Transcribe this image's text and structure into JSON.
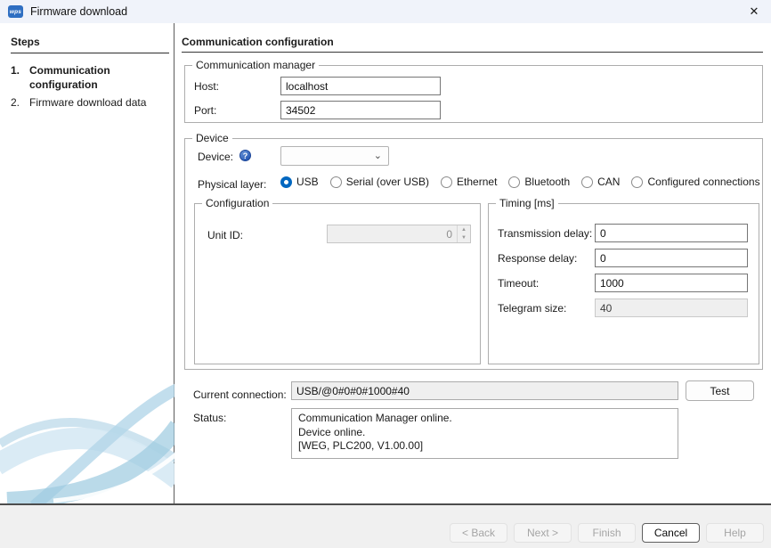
{
  "window": {
    "title": "Firmware download",
    "app_icon_text": "wps"
  },
  "icons": {
    "close": "✕",
    "chevron_down": "⌄",
    "help": "?",
    "spin_up": "▲",
    "spin_down": "▼"
  },
  "sidebar": {
    "heading": "Steps",
    "steps": [
      {
        "number": "1.",
        "label": "Communication configuration"
      },
      {
        "number": "2.",
        "label": "Firmware download data"
      }
    ]
  },
  "main": {
    "header": "Communication configuration",
    "comm_manager": {
      "legend": "Communication manager",
      "host_label": "Host:",
      "host_value": "localhost",
      "port_label": "Port:",
      "port_value": "34502"
    },
    "device": {
      "legend": "Device",
      "device_label": "Device:",
      "device_value": "",
      "physical_layer_label": "Physical layer:",
      "options": [
        {
          "label": "USB",
          "selected": true
        },
        {
          "label": "Serial (over USB)",
          "selected": false
        },
        {
          "label": "Ethernet",
          "selected": false
        },
        {
          "label": "Bluetooth",
          "selected": false
        },
        {
          "label": "CAN",
          "selected": false
        },
        {
          "label": "Configured connections",
          "selected": false
        }
      ],
      "configuration": {
        "legend": "Configuration",
        "unit_id_label": "Unit ID:",
        "unit_id_value": "0"
      },
      "timing": {
        "legend": "Timing [ms]",
        "rows": [
          {
            "label": "Transmission delay:",
            "value": "0",
            "disabled": false
          },
          {
            "label": "Response delay:",
            "value": "0",
            "disabled": false
          },
          {
            "label": "Timeout:",
            "value": "1000",
            "disabled": false
          },
          {
            "label": "Telegram size:",
            "value": "40",
            "disabled": true
          }
        ]
      }
    },
    "connection": {
      "label": "Current connection:",
      "value": "USB/@0#0#0#1000#40",
      "test_button": "Test"
    },
    "status": {
      "label": "Status:",
      "lines": [
        "Communication Manager online.",
        "Device online.",
        "[WEG, PLC200, V1.00.00]"
      ]
    }
  },
  "footer": {
    "buttons": [
      {
        "label": "< Back",
        "enabled": false
      },
      {
        "label": "Next >",
        "enabled": false
      },
      {
        "label": "Finish",
        "enabled": false
      },
      {
        "label": "Cancel",
        "enabled": true
      },
      {
        "label": "Help",
        "enabled": false
      }
    ]
  },
  "colors": {
    "accent": "#0067c0",
    "titlebar_bg": "#f0f3fa",
    "footer_bg": "#f0f0f0",
    "swirl_blue": "#b3d6e9"
  }
}
